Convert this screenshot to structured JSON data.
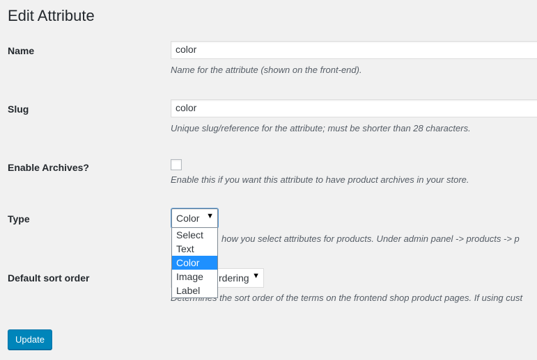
{
  "page": {
    "title": "Edit Attribute"
  },
  "fields": {
    "name": {
      "label": "Name",
      "value": "color",
      "description": "Name for the attribute (shown on the front-end)."
    },
    "slug": {
      "label": "Slug",
      "value": "color",
      "description": "Unique slug/reference for the attribute; must be shorter than 28 characters."
    },
    "archives": {
      "label": "Enable Archives?",
      "checked": false,
      "description": "Enable this if you want this attribute to have product archives in your store."
    },
    "type": {
      "label": "Type",
      "selected": "Color",
      "options": [
        "Select",
        "Text",
        "Color",
        "Image",
        "Label"
      ],
      "description_visible_part": "how you select attributes for products. Under admin panel -> products -> p"
    },
    "sort": {
      "label": "Default sort order",
      "selected_visible_part": "rdering",
      "description_visible_part": "Determines the sort order of the terms on the frontend shop product pages. If using cust"
    }
  },
  "actions": {
    "update_label": "Update"
  },
  "icons": {
    "dropdown_arrow": "▼"
  },
  "colors": {
    "accent": "#0085ba",
    "selected_option": "#1e90ff"
  }
}
